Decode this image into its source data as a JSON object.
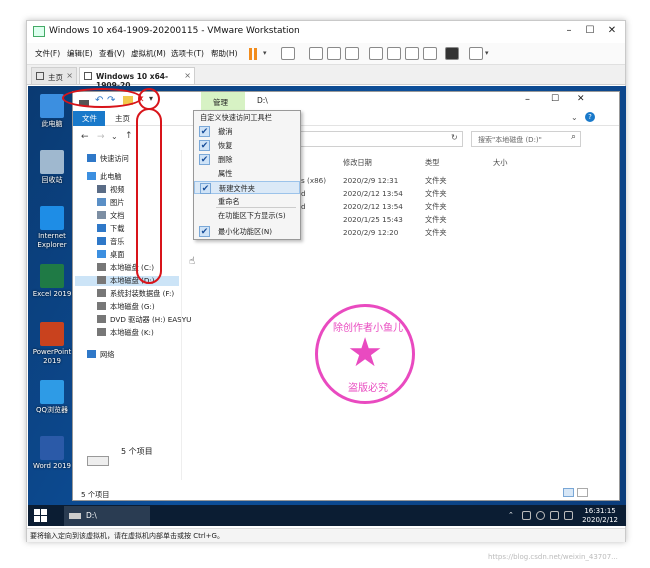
{
  "vmware": {
    "title": "Windows 10 x64-1909-20200115 - VMware Workstation",
    "menu": [
      "文件(F)",
      "编辑(E)",
      "查看(V)",
      "虚拟机(M)",
      "选项卡(T)",
      "帮助(H)"
    ],
    "tabs": [
      {
        "label": "主页"
      },
      {
        "label": "Windows 10 x64-1909-20..."
      }
    ],
    "status": "要将输入定向到该虚拟机，请在虚拟机内部单击或按 Ctrl+G。"
  },
  "desktop_icons": [
    {
      "label": "此电脑",
      "icon": "computer-icon",
      "color": "#3c8fe0"
    },
    {
      "label": "回收站",
      "icon": "recycle-bin-icon",
      "color": "#9fb8cf"
    },
    {
      "label": "Internet\nExplorer",
      "icon": "ie-icon",
      "color": "#1e8de6"
    },
    {
      "label": "Excel 2019",
      "icon": "excel-icon",
      "color": "#1f7a45"
    },
    {
      "label": "PowerPoint\n2019",
      "icon": "powerpoint-icon",
      "color": "#c9421e"
    },
    {
      "label": "QQ浏览器",
      "icon": "qq-browser-icon",
      "color": "#2e9be6"
    },
    {
      "label": "Word 2019",
      "icon": "word-icon",
      "color": "#2b5aa8"
    }
  ],
  "explorer": {
    "path": "D:\\",
    "ribbon_tabs": [
      "文件",
      "主页",
      "管理"
    ],
    "search_placeholder": "搜索\"本地磁盘 (D:)\"",
    "columns": [
      "修改日期",
      "类型",
      "大小"
    ],
    "nav": [
      {
        "label": "快速访问",
        "icon": "star-icon",
        "color": "#2f78c8"
      },
      {
        "label": "此电脑",
        "icon": "computer-icon",
        "color": "#3c8fe0"
      },
      {
        "label": "视频",
        "icon": "video-icon",
        "color": "#5a6c86"
      },
      {
        "label": "图片",
        "icon": "picture-icon",
        "color": "#5a8fc6"
      },
      {
        "label": "文档",
        "icon": "document-icon",
        "color": "#7c8ea3"
      },
      {
        "label": "下载",
        "icon": "download-icon",
        "color": "#2f78c8"
      },
      {
        "label": "音乐",
        "icon": "music-icon",
        "color": "#2f78c8"
      },
      {
        "label": "桌面",
        "icon": "desktop-icon",
        "color": "#3c8fe0"
      },
      {
        "label": "本地磁盘 (C:)",
        "icon": "drive-icon",
        "color": "#777777"
      },
      {
        "label": "本地磁盘 (D:)",
        "icon": "drive-icon",
        "color": "#777777",
        "selected": true
      },
      {
        "label": "系统封装数据盘 (F:)",
        "icon": "drive-icon",
        "color": "#777777"
      },
      {
        "label": "本地磁盘 (G:)",
        "icon": "drive-icon",
        "color": "#777777"
      },
      {
        "label": "DVD 驱动器 (H:) EASYU",
        "icon": "dvd-icon",
        "color": "#777777"
      },
      {
        "label": "本地磁盘 (K:)",
        "icon": "drive-icon",
        "color": "#777777"
      },
      {
        "label": "网络",
        "icon": "network-icon",
        "color": "#2f78c8"
      }
    ],
    "files": [
      {
        "name_tail": "s (x86)",
        "date": "2020/2/9 12:31",
        "type": "文件夹"
      },
      {
        "name_tail": "d",
        "date": "2020/2/12 13:54",
        "type": "文件夹"
      },
      {
        "name_tail": "d",
        "date": "2020/2/12 13:54",
        "type": "文件夹"
      },
      {
        "name_tail": "",
        "date": "2020/1/25 15:43",
        "type": "文件夹"
      },
      {
        "name_tail": "",
        "date": "2020/2/9 12:20",
        "type": "文件夹"
      }
    ],
    "item_count_main": "5 个项目",
    "item_count_status": "5 个项目"
  },
  "quick_menu": {
    "title": "自定义快速访问工具栏",
    "items": [
      {
        "label": "撤消",
        "checked": true
      },
      {
        "label": "恢复",
        "checked": true
      },
      {
        "label": "删除",
        "checked": true
      },
      {
        "label": "属性",
        "checked": false
      },
      {
        "label": "新建文件夹",
        "checked": true,
        "hover": true
      },
      {
        "label": "重命名",
        "checked": false
      },
      {
        "label": "在功能区下方显示(S)",
        "checked": false
      },
      {
        "label": "最小化功能区(N)",
        "checked": true
      }
    ]
  },
  "taskbar": {
    "app_label": "D:\\",
    "time": "16:31:15",
    "date": "2020/2/12"
  },
  "stamp": {
    "top": "除创作者小鱼儿",
    "bottom": "盗版必究"
  },
  "watermark": "https://blog.csdn.net/weixin_43707..."
}
